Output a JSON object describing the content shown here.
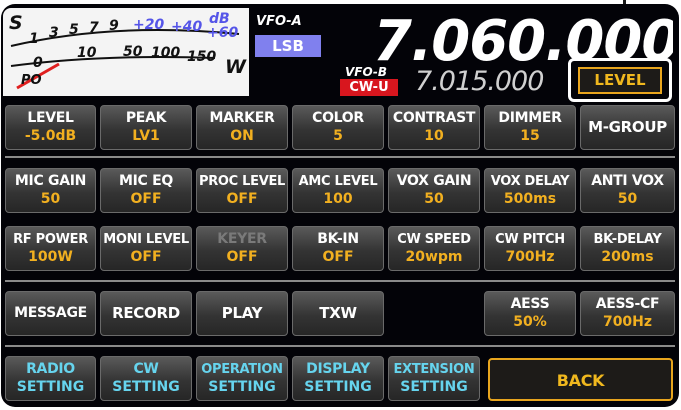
{
  "meter": {
    "s_label": "S",
    "s_scale": [
      "1",
      "3",
      "5",
      "7",
      "9",
      "+20",
      "+40",
      "+60"
    ],
    "db_label": "dB",
    "po_scale": [
      "0",
      "10",
      "50",
      "100",
      "150"
    ],
    "po_label": "PO",
    "w_label": "W"
  },
  "vfo_a": {
    "label": "VFO-A",
    "mode": "LSB",
    "frequency": "7.060.000"
  },
  "vfo_b": {
    "label": "VFO-B",
    "mode": "CW-U",
    "frequency": "7.015.000"
  },
  "level_button": {
    "label": "LEVEL"
  },
  "row1": [
    {
      "title": "LEVEL",
      "value": "-5.0dB"
    },
    {
      "title": "PEAK",
      "value": "LV1"
    },
    {
      "title": "MARKER",
      "value": "ON"
    },
    {
      "title": "COLOR",
      "value": "5"
    },
    {
      "title": "CONTRAST",
      "value": "10"
    },
    {
      "title": "DIMMER",
      "value": "15"
    },
    {
      "title": "M-GROUP",
      "value": ""
    }
  ],
  "row2": [
    {
      "title": "MIC GAIN",
      "value": "50"
    },
    {
      "title": "MIC EQ",
      "value": "OFF"
    },
    {
      "title": "PROC LEVEL",
      "value": "OFF"
    },
    {
      "title": "AMC LEVEL",
      "value": "100"
    },
    {
      "title": "VOX GAIN",
      "value": "50"
    },
    {
      "title": "VOX DELAY",
      "value": "500ms"
    },
    {
      "title": "ANTI VOX",
      "value": "50"
    }
  ],
  "row3": [
    {
      "title": "RF POWER",
      "value": "100W"
    },
    {
      "title": "MONI LEVEL",
      "value": "OFF"
    },
    {
      "title": "KEYER",
      "value": "OFF"
    },
    {
      "title": "BK-IN",
      "value": "OFF"
    },
    {
      "title": "CW SPEED",
      "value": "20wpm"
    },
    {
      "title": "CW PITCH",
      "value": "700Hz"
    },
    {
      "title": "BK-DELAY",
      "value": "200ms"
    }
  ],
  "row4": [
    {
      "title": "MESSAGE",
      "value": ""
    },
    {
      "title": "RECORD",
      "value": ""
    },
    {
      "title": "PLAY",
      "value": ""
    },
    {
      "title": "TXW",
      "value": ""
    },
    {
      "title": "AESS",
      "value": "50%"
    },
    {
      "title": "AESS-CF",
      "value": "700Hz"
    }
  ],
  "settings": [
    {
      "line1": "RADIO",
      "line2": "SETTING"
    },
    {
      "line1": "CW",
      "line2": "SETTING"
    },
    {
      "line1": "OPERATION",
      "line2": "SETTING"
    },
    {
      "line1": "DISPLAY",
      "line2": "SETTING"
    },
    {
      "line1": "EXTENSION",
      "line2": "SETTING"
    }
  ],
  "back": {
    "label": "BACK"
  },
  "colors": {
    "value_text": "#f2b020",
    "setting_text": "#66d4ee",
    "vfo_a_mode_bg": "#8080ee",
    "vfo_b_mode_bg": "#d8161e",
    "highlight_border": "#e8a51e"
  }
}
